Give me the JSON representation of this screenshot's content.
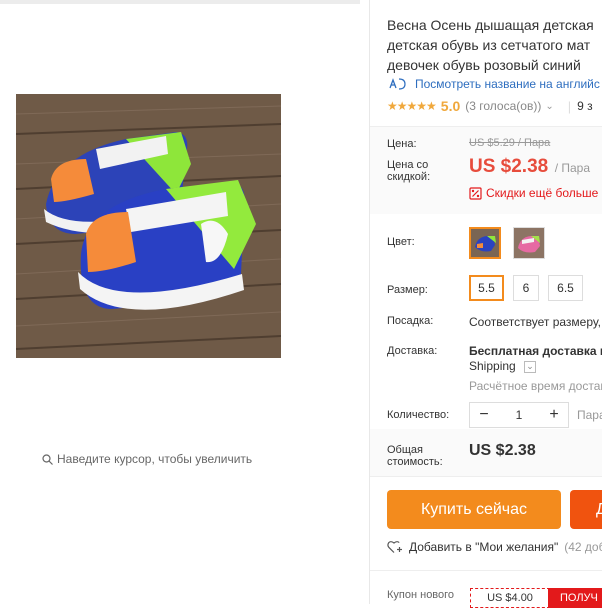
{
  "gallery": {
    "zoom_hint": "Наведите курсор, чтобы увеличить"
  },
  "product": {
    "title_lines": [
      "Весна Осень дышащая детская",
      "детская обувь из сетчатого мат",
      "девочек обувь розовый синий"
    ],
    "translate_link": "Посмотреть название на английс",
    "rating": {
      "stars": 5,
      "value": "5.0",
      "votes": "(3 голоса(ов))",
      "orders": "9 з"
    }
  },
  "price": {
    "label": "Цена:",
    "old": "US $5.29 / Пара",
    "discount_label_1": "Цена со",
    "discount_label_2": "скидкой:",
    "new": "US $2.38",
    "unit": "/ Пара",
    "more_discounts": "Скидки ещё больше"
  },
  "options": {
    "color_label": "Цвет:",
    "colors": [
      "blue-green-shoe",
      "pink-shoe"
    ],
    "size_label": "Размер:",
    "sizes": [
      "5.5",
      "6",
      "6.5"
    ],
    "selected_size": "5.5",
    "fit_label": "Посадка:",
    "fit_value": "Соответствует размеру,",
    "shipping_label": "Доставка:",
    "shipping_value_1": "Бесплатная доставка в",
    "shipping_value_2": "Shipping",
    "shipping_estimate": "Расчётное время достав",
    "quantity_label": "Количество:",
    "quantity": "1",
    "quantity_unit": "Пара",
    "total_label_1": "Общая",
    "total_label_2": "стоимость:",
    "total": "US $2.38"
  },
  "actions": {
    "buy_now": "Купить сейчас",
    "add_to_cart": "Д",
    "wishlist": "Добавить в \"Мои желания\"",
    "wishlist_count": "(42 добав"
  },
  "coupon": {
    "label": "Купон нового",
    "amount": "US $4.00",
    "get": "ПОЛУЧ"
  },
  "colors": {
    "accent": "#f38b1d",
    "price": "#e74c3c",
    "cart": "#f0530f",
    "link": "#2e6ebf",
    "discount": "#e3191b",
    "star": "#f0a83c"
  }
}
